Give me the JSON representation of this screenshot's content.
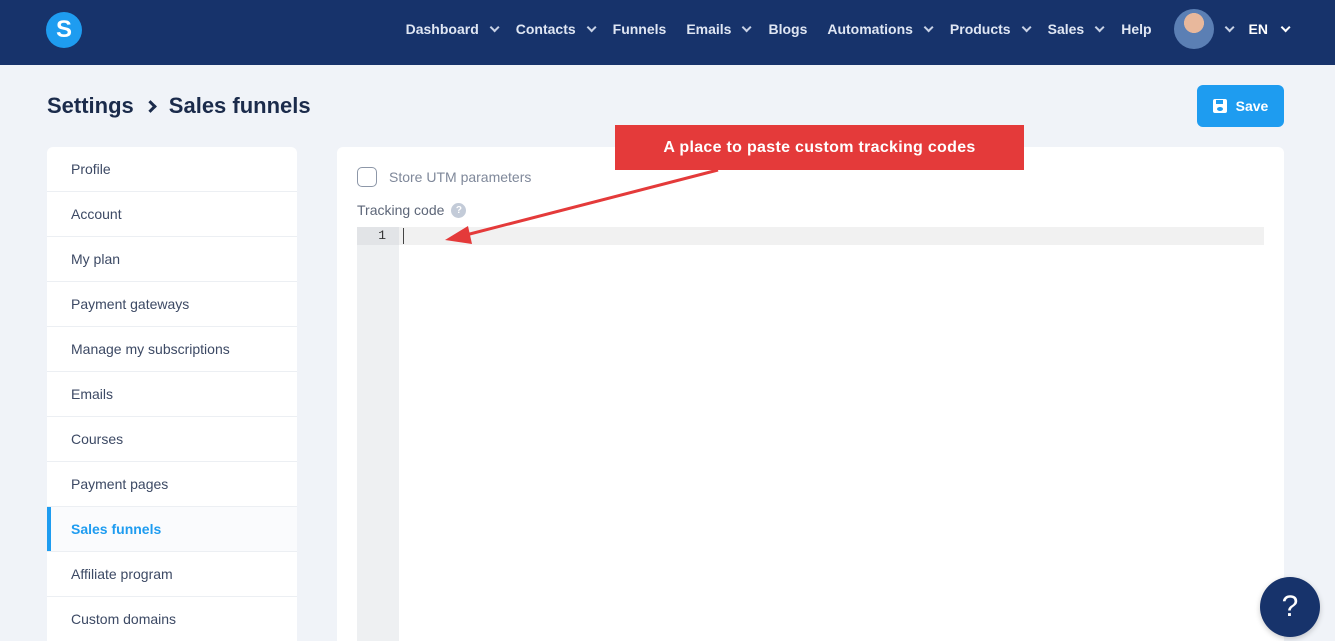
{
  "app": {
    "logo_letter": "S",
    "brand_color": "#1e9cf0",
    "nav_color": "#17336b"
  },
  "nav": {
    "items": [
      {
        "label": "Dashboard",
        "dropdown": true
      },
      {
        "label": "Contacts",
        "dropdown": true
      },
      {
        "label": "Funnels",
        "dropdown": false
      },
      {
        "label": "Emails",
        "dropdown": true
      },
      {
        "label": "Blogs",
        "dropdown": false
      },
      {
        "label": "Automations",
        "dropdown": true
      },
      {
        "label": "Products",
        "dropdown": true
      },
      {
        "label": "Sales",
        "dropdown": true
      },
      {
        "label": "Help",
        "dropdown": false
      }
    ],
    "language": "EN"
  },
  "header": {
    "breadcrumb_root": "Settings",
    "breadcrumb_current": "Sales funnels",
    "save_label": "Save"
  },
  "sidebar": {
    "items": [
      {
        "label": "Profile"
      },
      {
        "label": "Account"
      },
      {
        "label": "My plan"
      },
      {
        "label": "Payment gateways"
      },
      {
        "label": "Manage my subscriptions"
      },
      {
        "label": "Emails"
      },
      {
        "label": "Courses"
      },
      {
        "label": "Payment pages"
      },
      {
        "label": "Sales funnels",
        "active": true
      },
      {
        "label": "Affiliate program"
      },
      {
        "label": "Custom domains"
      }
    ]
  },
  "form": {
    "utm_label": "Store UTM parameters",
    "utm_checked": false,
    "tracking_label": "Tracking code",
    "help_glyph": "?",
    "editor_line_number": "1",
    "editor_value": ""
  },
  "annotation": {
    "text": "A place to paste custom tracking codes",
    "color": "#e43a3a"
  },
  "help_fab": {
    "glyph": "?"
  }
}
